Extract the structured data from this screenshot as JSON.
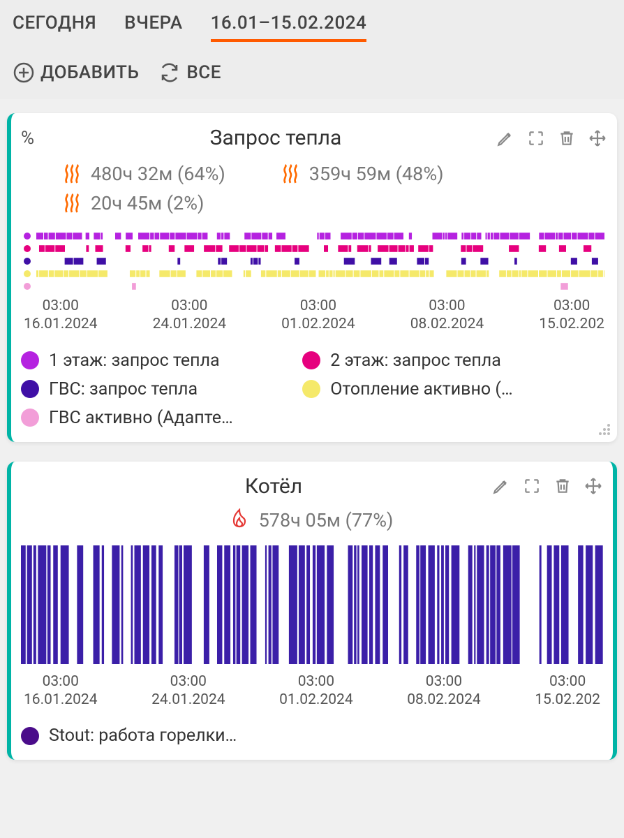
{
  "tabs": {
    "today": "СЕГОДНЯ",
    "yesterday": "ВЧЕРА",
    "range": "16.01–15.02.2024"
  },
  "actions": {
    "add": "ДОБАВИТЬ",
    "all": "ВСЕ"
  },
  "axis": [
    {
      "time": "03:00",
      "date": "16.01.2024"
    },
    {
      "time": "03:00",
      "date": "24.01.2024"
    },
    {
      "time": "03:00",
      "date": "01.02.2024"
    },
    {
      "time": "03:00",
      "date": "08.02.2024"
    },
    {
      "time": "03:00",
      "date": "15.02.202"
    }
  ],
  "colors": {
    "violet": "#b522e0",
    "magenta": "#e6007e",
    "indigo": "#3f0fa6",
    "yellow": "#f5e96a",
    "pink": "#f29ed8",
    "deepblue": "#3b1fa8",
    "deepviolet": "#4a0c8a"
  },
  "card1": {
    "unit": "%",
    "title": "Запрос тепла",
    "stats": [
      {
        "text": "480ч 32м (64%)"
      },
      {
        "text": "359ч 59м (48%)"
      },
      {
        "text": "20ч 45м (2%)"
      }
    ],
    "legend": [
      {
        "colorKey": "violet",
        "label": "1 этаж: запрос тепла"
      },
      {
        "colorKey": "magenta",
        "label": "2 этаж: запрос тепла"
      },
      {
        "colorKey": "indigo",
        "label": "ГВС: запрос тепла"
      },
      {
        "colorKey": "yellow",
        "label": "Отопление активно (…"
      },
      {
        "colorKey": "pink",
        "label": "ГВС активно (Адапте…"
      }
    ]
  },
  "card2": {
    "title": "Котёл",
    "stat": "578ч 05м (77%)",
    "legend": [
      {
        "colorKey": "deepviolet",
        "label": "Stout: работа горелки…"
      }
    ]
  },
  "chart_data": [
    {
      "type": "bar",
      "title": "Запрос тепла",
      "xlabel": "",
      "ylabel": "%",
      "x_range": [
        "16.01.2024 03:00",
        "15.02.2024 03:00"
      ],
      "series": [
        {
          "name": "1 этаж: запрос тепла",
          "color": "#b522e0",
          "approximate_on_fraction": 0.64
        },
        {
          "name": "2 этаж: запрос тепла",
          "color": "#e6007e",
          "approximate_on_fraction": 0.48
        },
        {
          "name": "ГВС: запрос тепла",
          "color": "#3f0fa6",
          "approximate_on_fraction": 0.25
        },
        {
          "name": "Отопление активно",
          "color": "#f5e96a",
          "approximate_on_fraction": 0.9
        },
        {
          "name": "ГВС активно (Адаптер)",
          "color": "#f29ed8",
          "approximate_on_fraction": 0.02
        }
      ]
    },
    {
      "type": "bar",
      "title": "Котёл",
      "xlabel": "",
      "ylabel": "",
      "x_range": [
        "16.01.2024 03:00",
        "15.02.2024 03:00"
      ],
      "series": [
        {
          "name": "Stout: работа горелки",
          "color": "#3b1fa8",
          "approximate_on_fraction": 0.77
        }
      ]
    }
  ]
}
